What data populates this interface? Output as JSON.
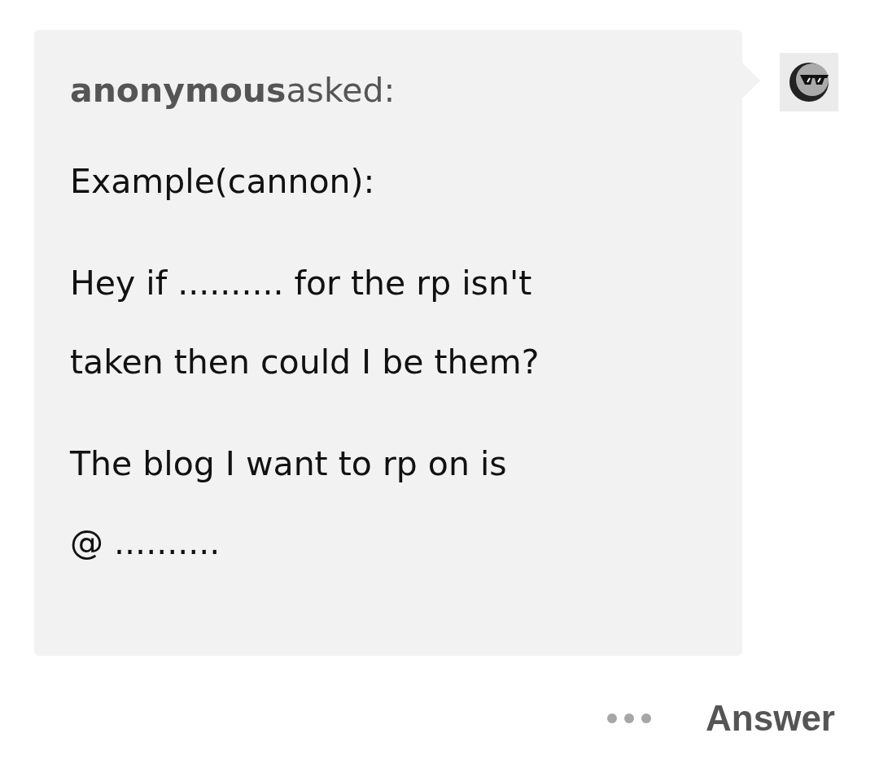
{
  "ask": {
    "asker": "anonymous",
    "verb": "asked:",
    "paragraphs": [
      [
        "Example(cannon):"
      ],
      [
        "Hey if .......... for the rp isn't",
        "taken then could I be them?"
      ],
      [
        "The blog I want to rp on is",
        "@ .........."
      ]
    ]
  },
  "actions": {
    "answer": "Answer"
  }
}
